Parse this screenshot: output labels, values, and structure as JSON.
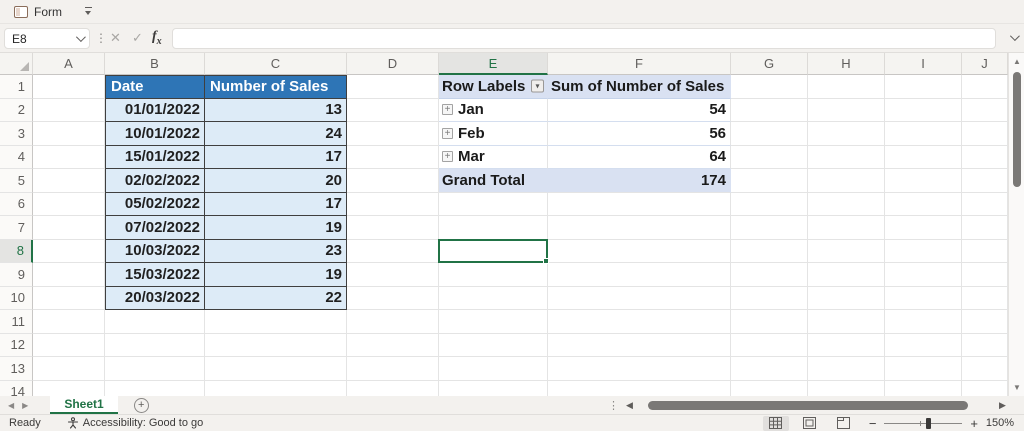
{
  "toolbar": {
    "form_label": "Form"
  },
  "formula_bar": {
    "name_box": "E8",
    "formula_value": ""
  },
  "sheet": {
    "columns": [
      "A",
      "B",
      "C",
      "D",
      "E",
      "F",
      "G",
      "H",
      "I",
      "J"
    ],
    "row_count": 14,
    "selected_cell": "E8",
    "data_table": {
      "start_cell": "B1",
      "headers": [
        "Date",
        "Number of Sales"
      ],
      "rows": [
        [
          "01/01/2022",
          "13"
        ],
        [
          "10/01/2022",
          "24"
        ],
        [
          "15/01/2022",
          "17"
        ],
        [
          "02/02/2022",
          "20"
        ],
        [
          "05/02/2022",
          "17"
        ],
        [
          "07/02/2022",
          "19"
        ],
        [
          "10/03/2022",
          "23"
        ],
        [
          "15/03/2022",
          "19"
        ],
        [
          "20/03/2022",
          "22"
        ]
      ]
    },
    "pivot_table": {
      "start_cell": "E1",
      "headers": [
        "Row Labels",
        "Sum of Number of Sales"
      ],
      "rows": [
        [
          "Jan",
          "54"
        ],
        [
          "Feb",
          "56"
        ],
        [
          "Mar",
          "64"
        ]
      ],
      "grand_total": [
        "Grand Total",
        "174"
      ]
    }
  },
  "tab_bar": {
    "sheets": [
      {
        "name": "Sheet1",
        "active": true
      }
    ]
  },
  "status_bar": {
    "ready_label": "Ready",
    "accessibility_label": "Accessibility: Good to go",
    "zoom_level": "150%"
  },
  "icons": {
    "cancel": "✕",
    "enter": "✓",
    "dots": "⋮",
    "filter_arrow": "▾",
    "expand_plus": "+",
    "up_arrow": "▲",
    "down_arrow": "▼",
    "left_arrow": "◀",
    "right_arrow": "▶",
    "add_sheet": "+",
    "zoom_minus": "−",
    "zoom_plus": "+"
  },
  "colors": {
    "accent_green": "#217346",
    "table_header_blue": "#2E75B6",
    "table_fill_blue": "#DDEBF7",
    "pivot_fill_blue": "#D9E1F2"
  }
}
